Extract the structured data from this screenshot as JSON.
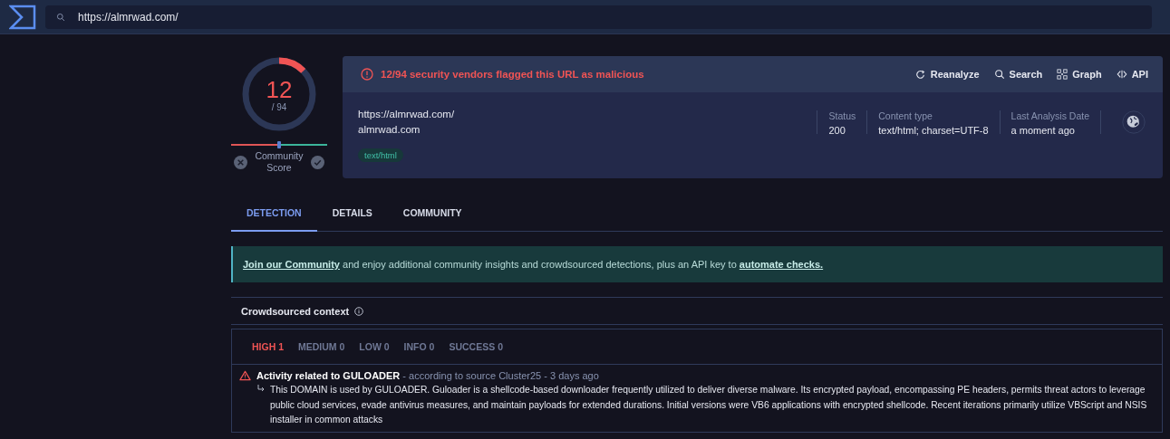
{
  "search": {
    "value": "https://almrwad.com/"
  },
  "score": {
    "detections": "12",
    "total": "/ 94",
    "level": 0.128,
    "community": {
      "label": "Community Score",
      "level": 0.5
    }
  },
  "summary": {
    "alert": "12/94 security vendors flagged this URL as malicious",
    "actions": [
      {
        "kind": "reanalyze",
        "label": "Reanalyze"
      },
      {
        "kind": "search",
        "label": "Search"
      },
      {
        "kind": "graph",
        "label": "Graph"
      },
      {
        "kind": "api",
        "label": "API"
      }
    ],
    "url": "https://almrwad.com/",
    "domain": "almrwad.com",
    "tag": "text/html",
    "fields": [
      {
        "label": "Status",
        "value": "200"
      },
      {
        "label": "Content type",
        "value": "text/html; charset=UTF-8"
      },
      {
        "label": "Last Analysis Date",
        "value": "a moment ago"
      }
    ]
  },
  "tabs": [
    {
      "label": "DETECTION",
      "selected": true
    },
    {
      "label": "DETAILS",
      "selected": false
    },
    {
      "label": "COMMUNITY",
      "selected": false
    }
  ],
  "banner": {
    "link": "Join our Community",
    "text": " and enjoy additional community insights and crowdsourced detections, plus an API key to ",
    "link2": "automate checks."
  },
  "crowdsourced": {
    "title": "Crowdsourced context",
    "filters": [
      {
        "label": "HIGH 1",
        "selected": true
      },
      {
        "label": "MEDIUM 0",
        "selected": false
      },
      {
        "label": "LOW 0",
        "selected": false
      },
      {
        "label": "INFO 0",
        "selected": false
      },
      {
        "label": "SUCCESS 0",
        "selected": false
      }
    ],
    "items": [
      {
        "title": "Activity related to GULOADER",
        "source": " - according to source Cluster25 - 3 days ago",
        "description": "This DOMAIN is used by GULOADER. Guloader is a shellcode-based downloader frequently utilized to deliver diverse malware. Its encrypted payload, encompassing PE headers, permits threat actors to leverage public cloud services, evade antivirus measures, and maintain payloads for extended durations. Initial versions were VB6 applications with encrypted shellcode. Recent iterations primarily utilize VBScript and NSIS installer in common attacks"
      }
    ]
  }
}
